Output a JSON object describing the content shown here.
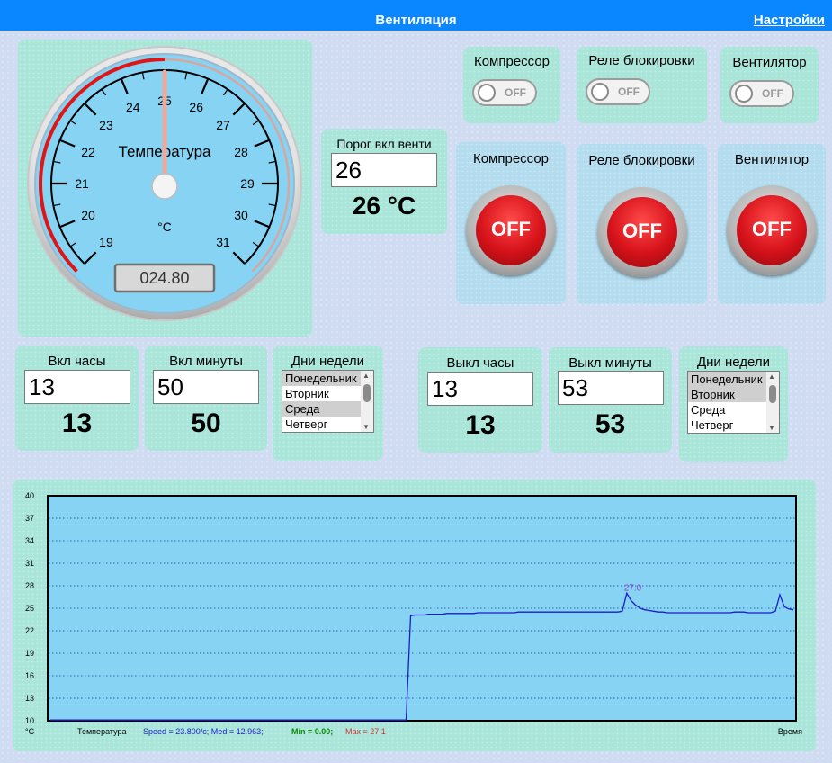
{
  "header": {
    "title": "Вентиляция",
    "settings_link": "Настройки"
  },
  "gauge": {
    "label": "Температура",
    "unit": "°C",
    "ticks": [
      "19",
      "20",
      "21",
      "22",
      "23",
      "24",
      "25",
      "26",
      "27",
      "28",
      "29",
      "30",
      "31"
    ],
    "value": 25.0,
    "display": "024.80"
  },
  "threshold": {
    "label": "Порог вкл венти",
    "input_value": "26",
    "display": "26 °C"
  },
  "toggles": [
    {
      "label": "Компрессор",
      "state": "OFF"
    },
    {
      "label": "Реле блокировки",
      "state": "OFF"
    },
    {
      "label": "Вентилятор",
      "state": "OFF"
    }
  ],
  "buttons": [
    {
      "label": "Компрессор",
      "state": "OFF"
    },
    {
      "label": "Реле блокировки",
      "state": "OFF"
    },
    {
      "label": "Вентилятор",
      "state": "OFF"
    }
  ],
  "on_schedule": {
    "hours_label": "Вкл часы",
    "hours_value": "13",
    "hours_display": "13",
    "minutes_label": "Вкл минуты",
    "minutes_value": "50",
    "minutes_display": "50",
    "days_label": "Дни недели",
    "days": [
      "Понедельник",
      "Вторник",
      "Среда",
      "Четверг"
    ],
    "days_selected": [
      true,
      false,
      true,
      false
    ]
  },
  "off_schedule": {
    "hours_label": "Выкл часы",
    "hours_value": "13",
    "hours_display": "13",
    "minutes_label": "Выкл минуты",
    "minutes_value": "53",
    "minutes_display": "53",
    "days_label": "Дни недели",
    "days": [
      "Понедельник",
      "Вторник",
      "Среда",
      "Четверг"
    ],
    "days_selected": [
      true,
      true,
      false,
      false
    ]
  },
  "chart_data": {
    "type": "line",
    "series_name": "Температура",
    "ylim": [
      10,
      40
    ],
    "yticks": [
      10,
      13,
      16,
      19,
      22,
      25,
      28,
      31,
      34,
      37,
      40
    ],
    "grid": true,
    "unit_label": "°C",
    "xlabel": "Время",
    "peak_label": "27.0",
    "stats": {
      "speed": "Speed = 23.800/c; Med = 12.963;",
      "min": "Min = 0.00;",
      "max": "Max = 27.1"
    },
    "colors": {
      "line": "#1c1cc8",
      "plot_bg": "#86d3f3",
      "min": "#0a8a0a",
      "max": "#d03030",
      "speed": "#1c1cc8"
    },
    "values": [
      10.1,
      10.1,
      10.1,
      10.1,
      10.1,
      10.1,
      10.1,
      10.1,
      10.1,
      10.1,
      10.1,
      10.1,
      10.1,
      10.1,
      10.1,
      10.1,
      10.1,
      10.1,
      10.1,
      10.1,
      10.1,
      10.1,
      10.1,
      10.1,
      10.1,
      10.1,
      10.1,
      10.1,
      10.1,
      10.1,
      10.1,
      10.1,
      10.1,
      10.1,
      10.1,
      10.1,
      10.1,
      10.1,
      10.1,
      10.1,
      10.1,
      10.1,
      10.1,
      10.1,
      10.1,
      10.1,
      10.1,
      10.1,
      10.1,
      10.1,
      10.1,
      10.1,
      10.1,
      10.1,
      10.1,
      10.1,
      10.1,
      10.1,
      10.1,
      10.1,
      10.1,
      10.1,
      10.1,
      10.1,
      10.1,
      10.1,
      10.1,
      10.1,
      10.1,
      10.1,
      10.1,
      10.1,
      10.1,
      10.1,
      10.1,
      10.1,
      10.1,
      10.1,
      10.1,
      10.1,
      24.0,
      24.1,
      24.1,
      24.1,
      24.2,
      24.2,
      24.2,
      24.2,
      24.3,
      24.3,
      24.3,
      24.3,
      24.3,
      24.3,
      24.3,
      24.4,
      24.4,
      24.4,
      24.4,
      24.4,
      24.4,
      24.4,
      24.4,
      24.4,
      24.5,
      24.5,
      24.5,
      24.5,
      24.5,
      24.5,
      24.5,
      24.5,
      24.5,
      24.5,
      24.5,
      24.5,
      24.5,
      24.5,
      24.5,
      24.5,
      24.5,
      24.5,
      24.5,
      24.5,
      24.5,
      24.5,
      24.5,
      24.6,
      27.0,
      26.0,
      25.4,
      25.0,
      24.8,
      24.7,
      24.6,
      24.5,
      24.5,
      24.4,
      24.4,
      24.4,
      24.4,
      24.4,
      24.4,
      24.4,
      24.4,
      24.4,
      24.4,
      24.4,
      24.4,
      24.4,
      24.4,
      24.4,
      24.5,
      24.5,
      24.5,
      24.4,
      24.4,
      24.4,
      24.4,
      24.4,
      24.4,
      24.6,
      26.8,
      25.2,
      24.9,
      24.8
    ]
  }
}
